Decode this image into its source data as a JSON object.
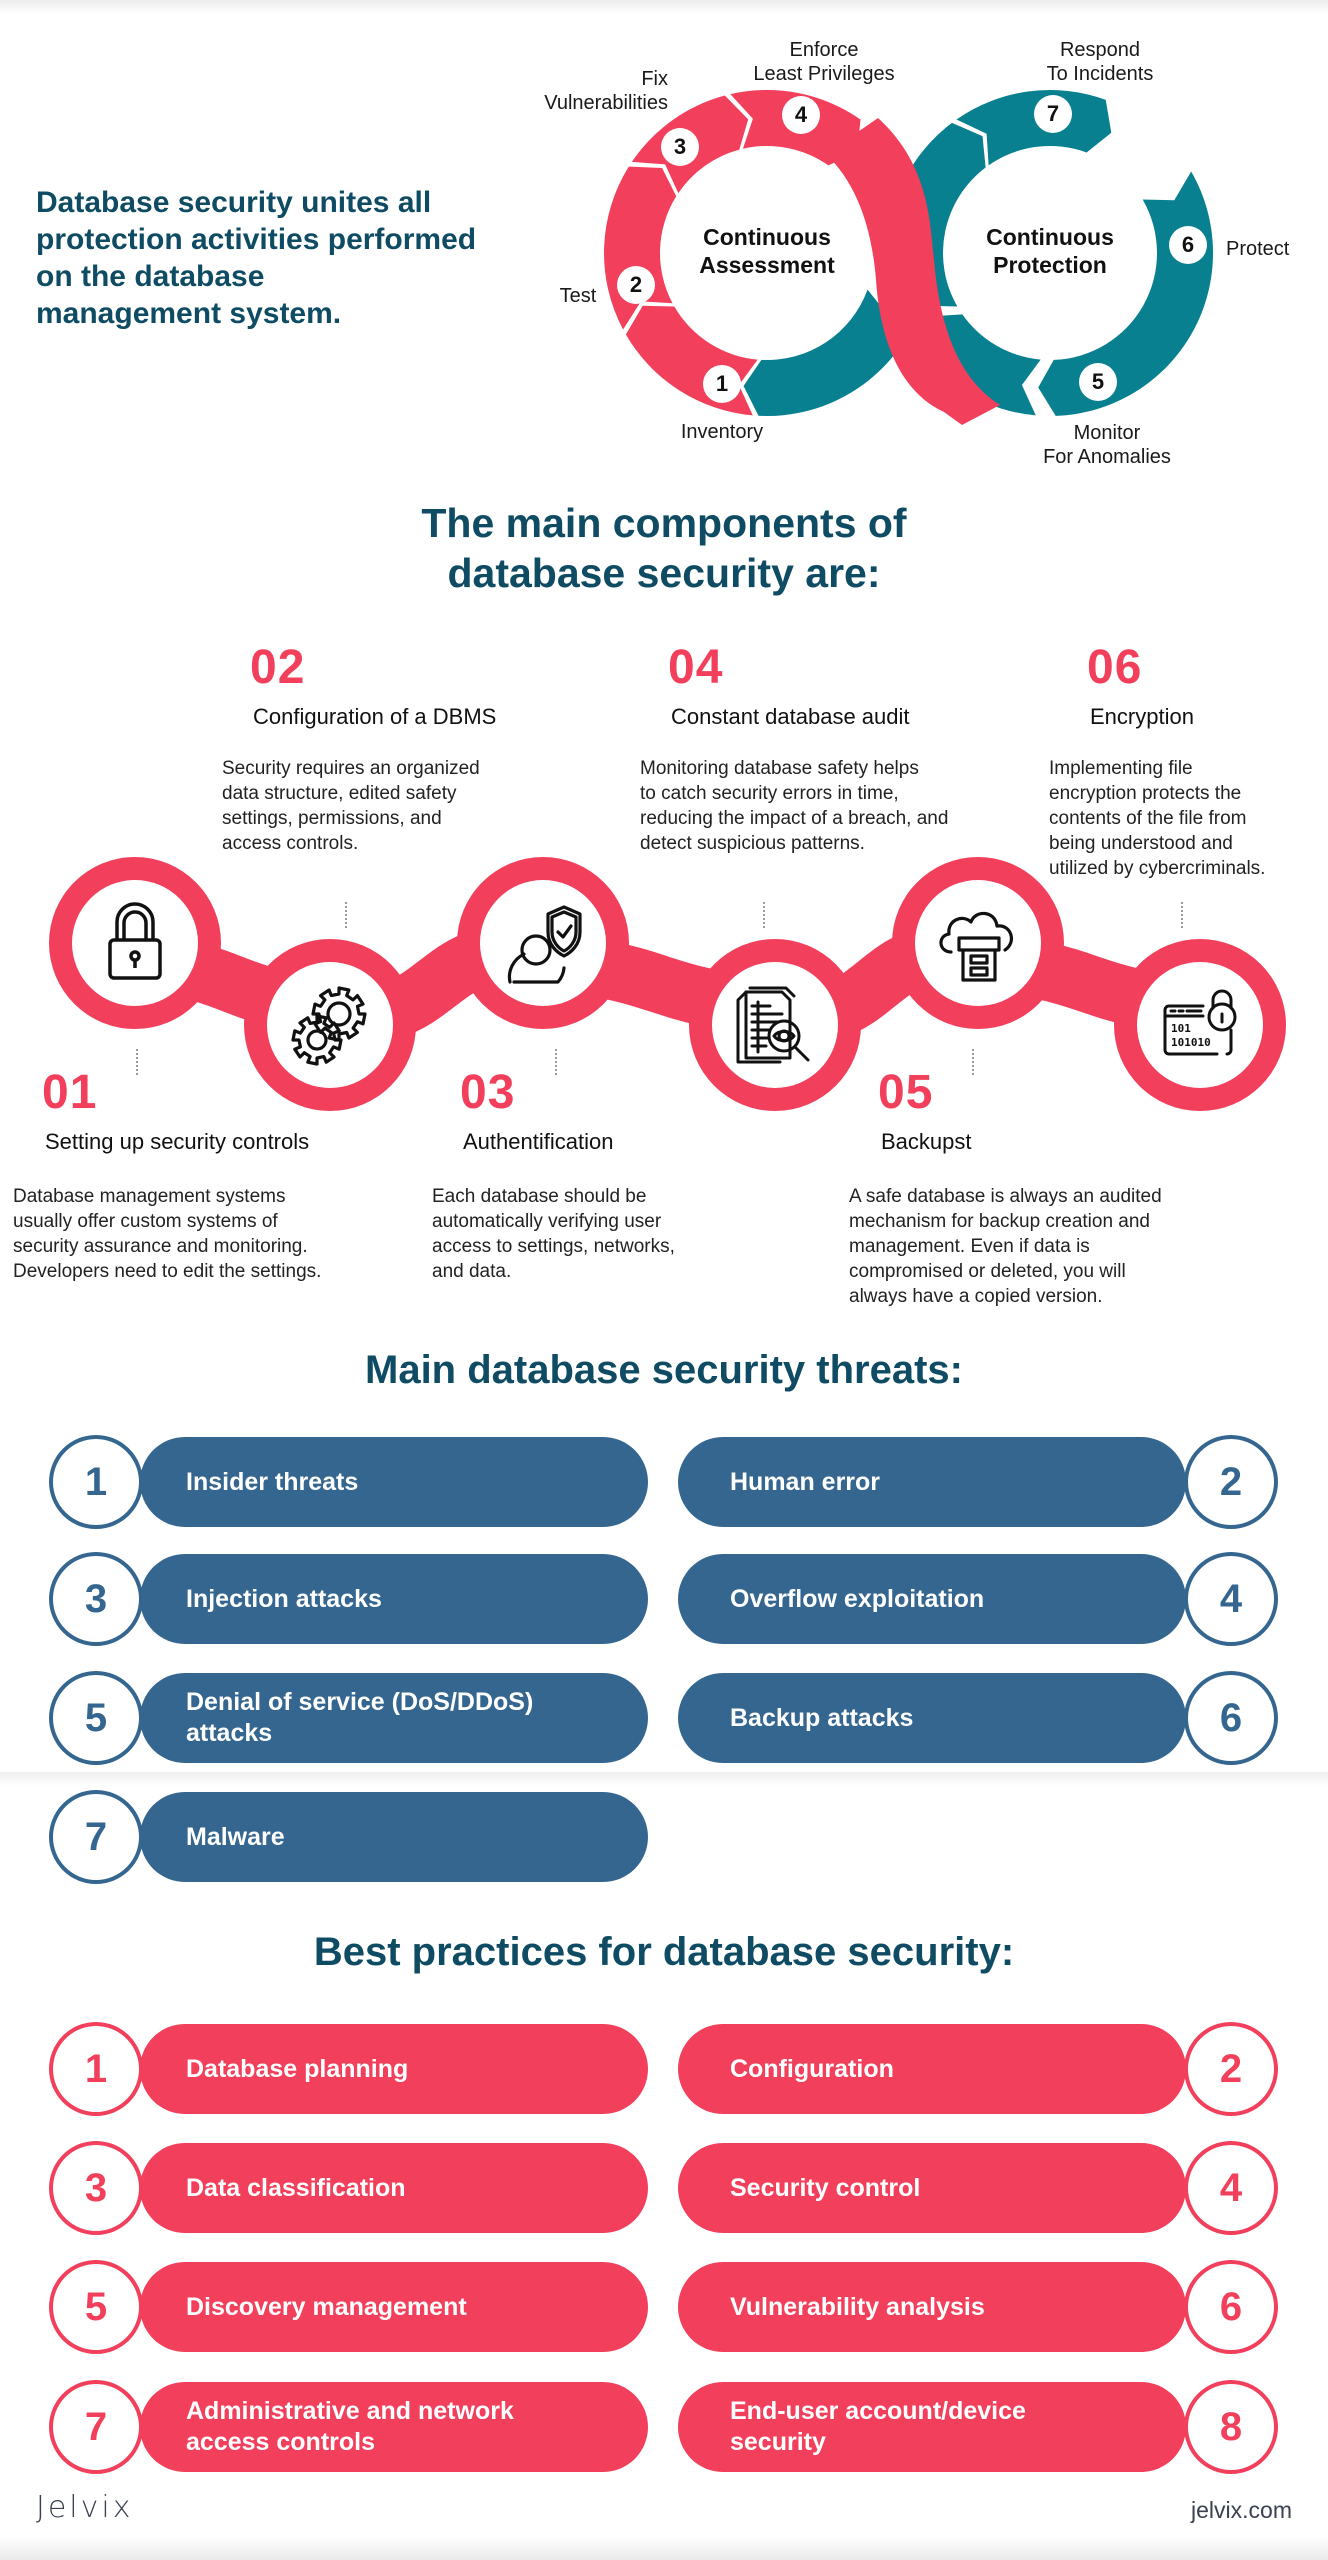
{
  "intro": {
    "lines": [
      "Database security unites all",
      "protection activities performed",
      "on the database",
      "management system."
    ]
  },
  "cycle": {
    "colors": {
      "assessment": "#f23f5c",
      "protection": "#08808f"
    },
    "assessment_title": [
      "Continuous",
      "Assessment"
    ],
    "protection_title": [
      "Continuous",
      "Protection"
    ],
    "steps": [
      {
        "num": "1",
        "label": [
          "Inventory"
        ]
      },
      {
        "num": "2",
        "label": [
          "Test"
        ]
      },
      {
        "num": "3",
        "label": [
          "Fix",
          "Vulnerabilities"
        ]
      },
      {
        "num": "4",
        "label": [
          "Enforce",
          "Least Privileges"
        ]
      },
      {
        "num": "5",
        "label": [
          "Monitor",
          "For Anomalies"
        ]
      },
      {
        "num": "6",
        "label": [
          "Protect"
        ]
      },
      {
        "num": "7",
        "label": [
          "Respond",
          "To Incidents"
        ]
      }
    ]
  },
  "components": {
    "title": [
      "The main components of",
      "database security are:"
    ],
    "accent": "#f23f5c",
    "items": [
      {
        "num": "01",
        "heading": "Setting up security controls",
        "icon": "padlock-icon",
        "text": [
          "Database management systems",
          "usually offer custom systems of",
          "security assurance and monitoring.",
          "Developers need to edit the settings."
        ]
      },
      {
        "num": "02",
        "heading": "Configuration of a DBMS",
        "icon": "gears-icon",
        "text": [
          "Security requires an organized",
          "data structure, edited safety",
          "settings, permissions, and",
          "access controls."
        ]
      },
      {
        "num": "03",
        "heading": "Authentification",
        "icon": "user-shield-icon",
        "text": [
          "Each database should be",
          "automatically verifying user",
          "access to settings, networks,",
          "and data."
        ]
      },
      {
        "num": "04",
        "heading": "Constant database audit",
        "icon": "document-audit-icon",
        "text": [
          "Monitoring database safety helps",
          "to catch security errors in time,",
          "reducing the impact of a breach, and",
          "detect suspicious patterns."
        ]
      },
      {
        "num": "05",
        "heading": "Backupst",
        "icon": "cloud-backup-icon",
        "text": [
          "A safe database is always an audited",
          "mechanism for backup creation and",
          "management. Even if data is",
          "compromised or deleted, you will",
          "always have a copied version."
        ]
      },
      {
        "num": "06",
        "heading": "Encryption",
        "icon": "binary-lock-icon",
        "text": [
          "Implementing file",
          "encryption protects the",
          "contents of the file from",
          "being understood and",
          "utilized by cybercriminals."
        ]
      }
    ]
  },
  "threats": {
    "title": "Main database security threats:",
    "color": "#35668f",
    "items": [
      {
        "num": "1",
        "label": [
          "Insider threats"
        ]
      },
      {
        "num": "2",
        "label": [
          "Human error"
        ]
      },
      {
        "num": "3",
        "label": [
          "Injection attacks"
        ]
      },
      {
        "num": "4",
        "label": [
          "Overflow exploitation"
        ]
      },
      {
        "num": "5",
        "label": [
          "Denial of service (DoS/DDoS)",
          "attacks"
        ]
      },
      {
        "num": "6",
        "label": [
          "Backup attacks"
        ]
      },
      {
        "num": "7",
        "label": [
          "Malware"
        ]
      }
    ]
  },
  "practices": {
    "title": "Best practices for database security:",
    "color": "#f23f5c",
    "items": [
      {
        "num": "1",
        "label": [
          "Database planning"
        ]
      },
      {
        "num": "2",
        "label": [
          "Configuration"
        ]
      },
      {
        "num": "3",
        "label": [
          "Data classification"
        ]
      },
      {
        "num": "4",
        "label": [
          "Security control"
        ]
      },
      {
        "num": "5",
        "label": [
          "Discovery management"
        ]
      },
      {
        "num": "6",
        "label": [
          "Vulnerability analysis"
        ]
      },
      {
        "num": "7",
        "label": [
          "Administrative and network",
          "access controls"
        ]
      },
      {
        "num": "8",
        "label": [
          "End-user account/device",
          "security"
        ]
      }
    ]
  },
  "footer": {
    "logo": "Jelvix",
    "site": "jelvix.com"
  }
}
